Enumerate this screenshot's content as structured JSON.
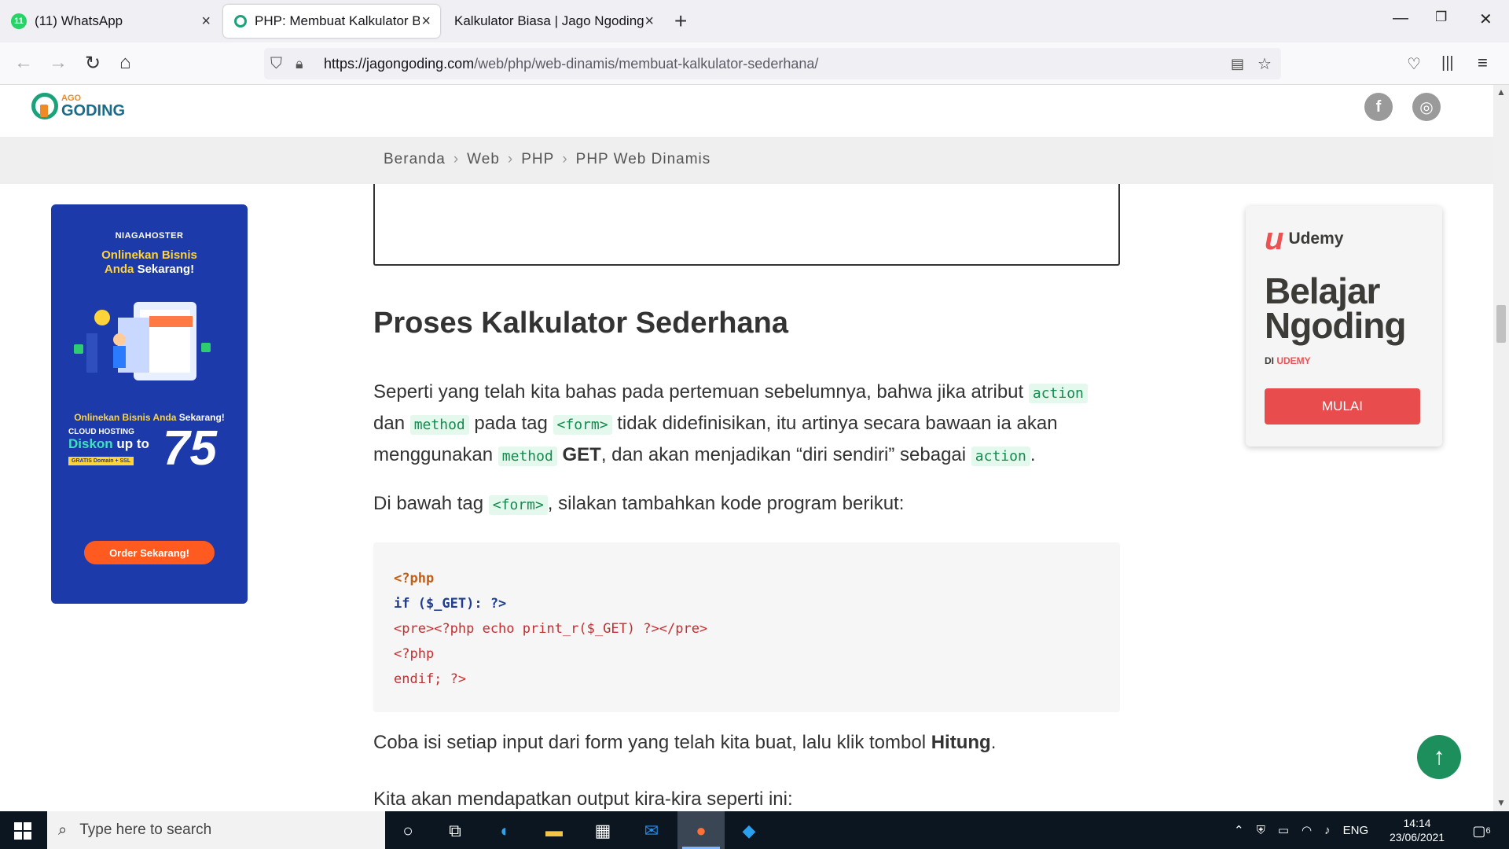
{
  "browser": {
    "tabs": [
      {
        "label": "(11) WhatsApp",
        "badge": "11"
      },
      {
        "label": "PHP: Membuat Kalkulator Biasa"
      },
      {
        "label": "Kalkulator Biasa | Jago Ngoding"
      }
    ],
    "url_host": "https://jagongoding.com",
    "url_path": "/web/php/web-dinamis/membuat-kalkulator-sederhana/"
  },
  "site": {
    "logo_small": "AGO",
    "logo_big": "GODING",
    "social": [
      "f",
      "◎"
    ]
  },
  "breadcrumb": [
    "Beranda",
    "Web",
    "PHP",
    "PHP Web Dinamis"
  ],
  "ad_left": {
    "brand": "NIAGAHOSTER",
    "headline_1": "Onlinekan Bisnis",
    "headline_2a": "Anda ",
    "headline_2b": "Sekarang!",
    "sub_a": "Onlinekan Bisnis Anda ",
    "sub_b": "Sekarang!",
    "promo_l1": "CLOUD HOSTING",
    "promo_l2a": "Diskon ",
    "promo_l2b": "up to",
    "promo_l3": "GRATIS Domain + SSL",
    "promo_big": "75",
    "button": "Order Sekarang!"
  },
  "ad_right": {
    "brand": "Udemy",
    "headline_1": "Belajar",
    "headline_2": "Ngoding",
    "di": "DI ",
    "di_brand": "UDEMY",
    "button": "MULAI"
  },
  "article": {
    "heading": "Proses Kalkulator Sederhana",
    "p1": {
      "t1": "Seperti yang telah kita bahas pada pertemuan sebelumnya, bahwa jika atribut ",
      "c1": "action",
      "t2": " dan ",
      "c2": "method",
      "t3": " pada tag ",
      "c3": "<form>",
      "t4": " tidak didefinisikan, itu artinya secara bawaan ia akan menggunakan ",
      "c4": "method",
      "b1": "GET",
      "t5": ", dan akan menjadikan “diri sendiri” sebagai ",
      "c5": "action",
      "t6": "."
    },
    "p2": {
      "t1": "Di bawah tag ",
      "c1": "<form>",
      "t2": ", silakan tambahkan kode program berikut:"
    },
    "code": [
      "<?php",
      "if ($_GET): ?>",
      "<pre><?php echo print_r($_GET) ?></pre>",
      "<?php",
      "endif; ?>"
    ],
    "p3": {
      "t1": "Coba isi setiap input dari form yang telah kita buat, lalu klik tombol ",
      "b1": "Hitung",
      "t2": "."
    },
    "p4": "Kita akan mendapatkan output kira-kira seperti ini:"
  },
  "taskbar": {
    "search_placeholder": "Type here to search",
    "lang": "ENG",
    "time": "14:14",
    "date": "23/06/2021",
    "notif_count": "6"
  },
  "colors": {
    "accent_green": "#1d8f5c",
    "inline_code": "#158a4e",
    "niagahoster_blue": "#1c3aa9",
    "udemy_red": "#ec5252"
  }
}
